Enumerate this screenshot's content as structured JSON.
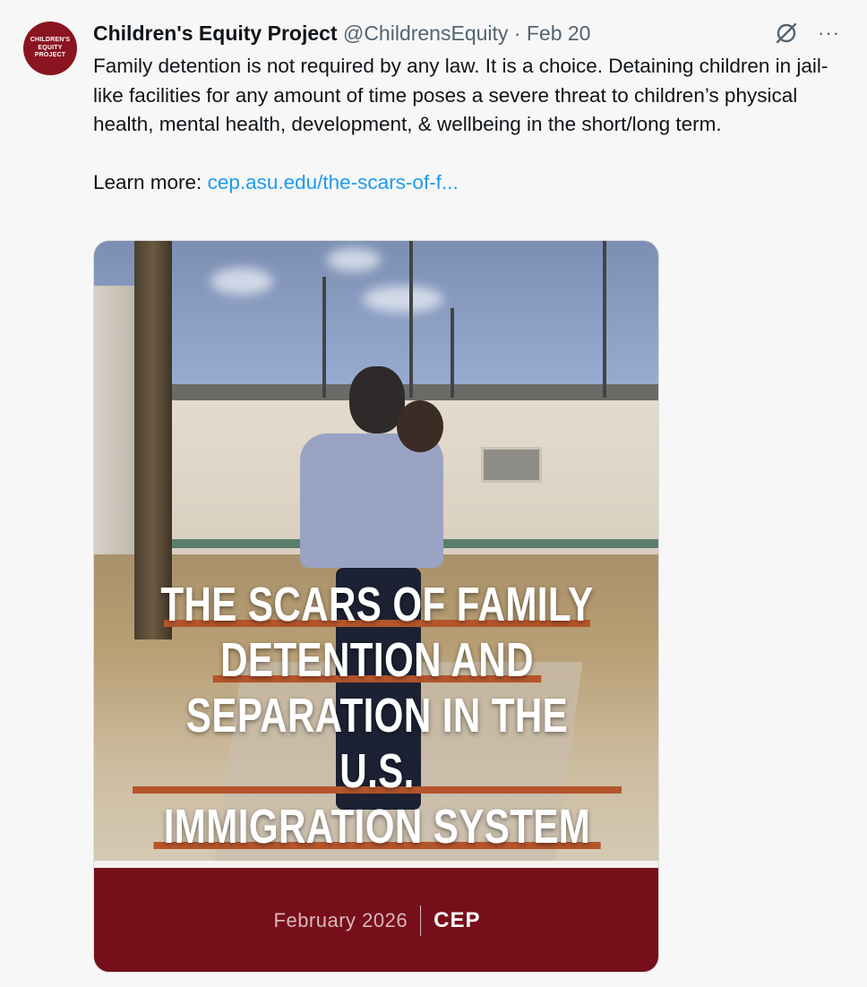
{
  "author": {
    "name": "Children's Equity Project",
    "handle": "@ChildrensEquity",
    "separator": "·",
    "date": "Feb 20",
    "avatar_lines": [
      "CHILDREN'S",
      "EQUITY",
      "PROJECT"
    ]
  },
  "tweet": {
    "body": "Family detention is not required by any law. It is a choice. Detaining children in jail-like facilities for any amount of time poses a severe threat to children’s physical health, mental health, development, & wellbeing in the short/long term.",
    "learn_more_label": "Learn more: ",
    "link_text": "cep.asu.edu/the-scars-of-f..."
  },
  "actions": {
    "grok_icon": "grok-icon",
    "more_label": "···"
  },
  "media": {
    "headline_lines": [
      "THE SCARS OF FAMILY",
      "DETENTION AND",
      "SEPARATION IN THE U.S.",
      "IMMIGRATION SYSTEM"
    ],
    "footer_date": "February 2026",
    "footer_logo": "CEP"
  },
  "colors": {
    "link": "#1d9bf0",
    "brand": "#770f1b",
    "accent_underline": "#b5552b"
  }
}
